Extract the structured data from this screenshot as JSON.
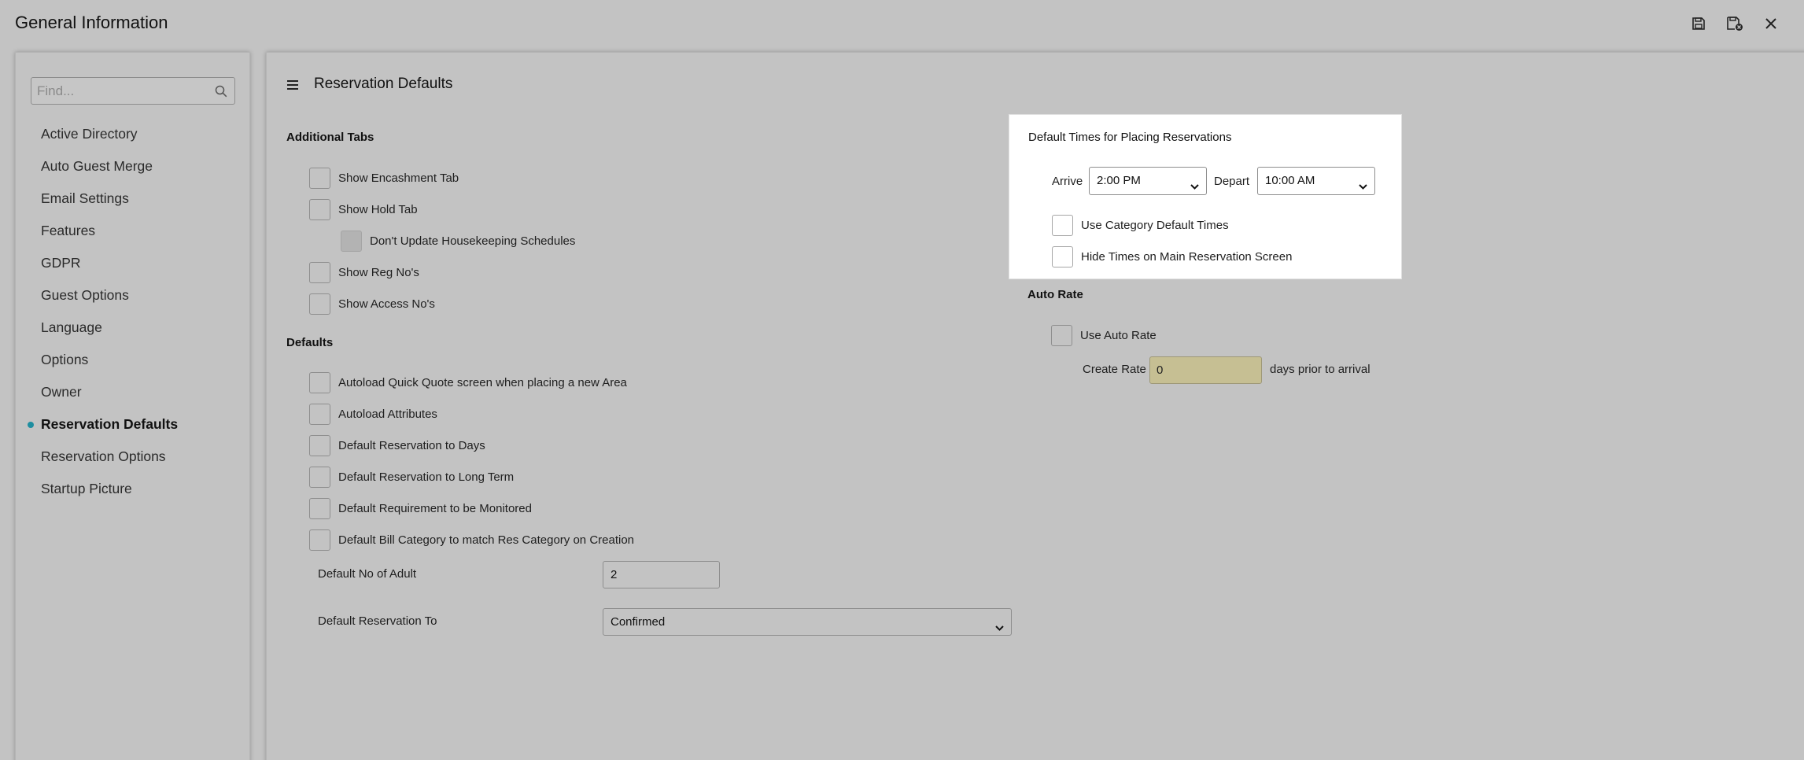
{
  "window": {
    "title": "General Information"
  },
  "toolbar": {
    "save_icon": "save-icon",
    "save_close_icon": "save-close-icon",
    "close_icon": "close-icon"
  },
  "sidebar": {
    "search_placeholder": "Find...",
    "items": [
      {
        "label": "Active Directory"
      },
      {
        "label": "Auto Guest Merge"
      },
      {
        "label": "Email Settings"
      },
      {
        "label": "Features"
      },
      {
        "label": "GDPR"
      },
      {
        "label": "Guest Options"
      },
      {
        "label": "Language"
      },
      {
        "label": "Options"
      },
      {
        "label": "Owner"
      },
      {
        "label": "Reservation Defaults",
        "active": true
      },
      {
        "label": "Reservation Options"
      },
      {
        "label": "Startup Picture"
      }
    ]
  },
  "main": {
    "title": "Reservation Defaults",
    "additional_tabs": {
      "title": "Additional Tabs",
      "show_encashment": "Show Encashment Tab",
      "show_hold": "Show Hold Tab",
      "dont_update_housekeeping": "Don't Update Housekeeping Schedules",
      "show_reg_nos": "Show Reg No's",
      "show_access_nos": "Show Access No's"
    },
    "defaults": {
      "title": "Defaults",
      "autoload_quick_quote": "Autoload Quick Quote screen when placing a new Area",
      "autoload_attributes": "Autoload Attributes",
      "default_res_days": "Default Reservation to Days",
      "default_res_long_term": "Default Reservation to Long Term",
      "default_requirement_monitored": "Default Requirement to be Monitored",
      "default_bill_category": "Default Bill Category to match Res Category on Creation",
      "no_of_adult_label": "Default No of Adult",
      "no_of_adult_value": "2",
      "res_to_label": "Default Reservation To",
      "res_to_value": "Confirmed"
    },
    "default_times": {
      "title": "Default Times for Placing Reservations",
      "arrive_label": "Arrive",
      "arrive_value": "2:00 PM",
      "depart_label": "Depart",
      "depart_value": "10:00 AM",
      "use_category_times": "Use Category Default Times",
      "hide_times": "Hide Times on Main Reservation Screen"
    },
    "auto_rate": {
      "title": "Auto Rate",
      "use_auto_rate": "Use Auto Rate",
      "create_rate_label": "Create Rate",
      "create_rate_value": "0",
      "days_suffix": "days prior to arrival"
    }
  },
  "colors": {
    "accent": "#1e8ea0",
    "background": "#c3c3c3",
    "highlight_field": "#c6bf93"
  }
}
